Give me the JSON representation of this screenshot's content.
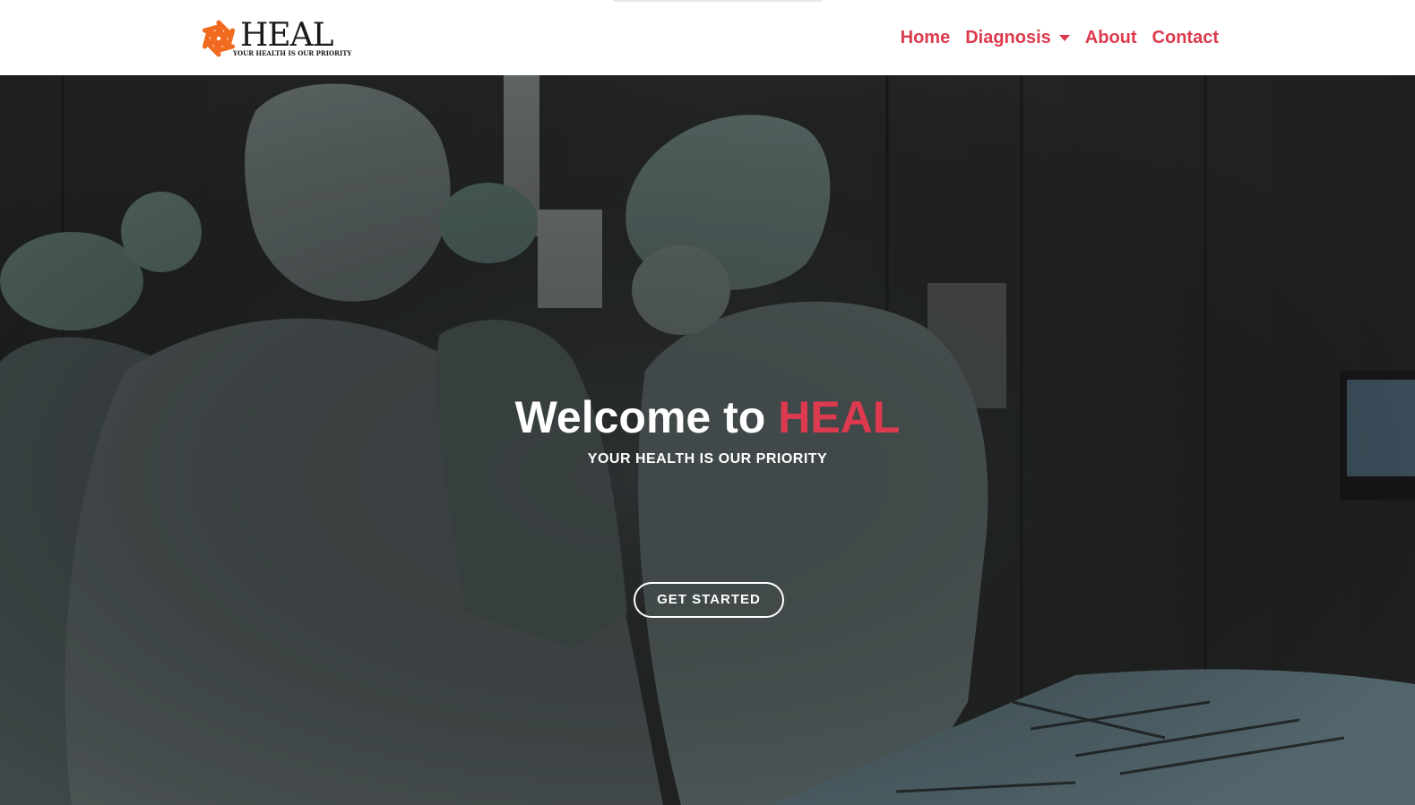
{
  "brand": {
    "name": "HEAL",
    "tagline": "YOUR HEALTH IS OUR PRIORITY",
    "logo_icon": "orange-flower-emblem-icon",
    "accent_color": "#dc3a4e",
    "logo_color": "#f06a1f"
  },
  "nav": {
    "items": [
      {
        "label": "Home"
      },
      {
        "label": "Diagnosis",
        "has_dropdown": true
      },
      {
        "label": "About"
      },
      {
        "label": "Contact"
      }
    ]
  },
  "hero": {
    "title_prefix": "Welcome to ",
    "title_brand": "HEAL",
    "subtitle": "YOUR HEALTH IS OUR PRIORITY",
    "cta_label": "GET STARTED",
    "background": "dark-operating-room-surgeons-photo"
  }
}
